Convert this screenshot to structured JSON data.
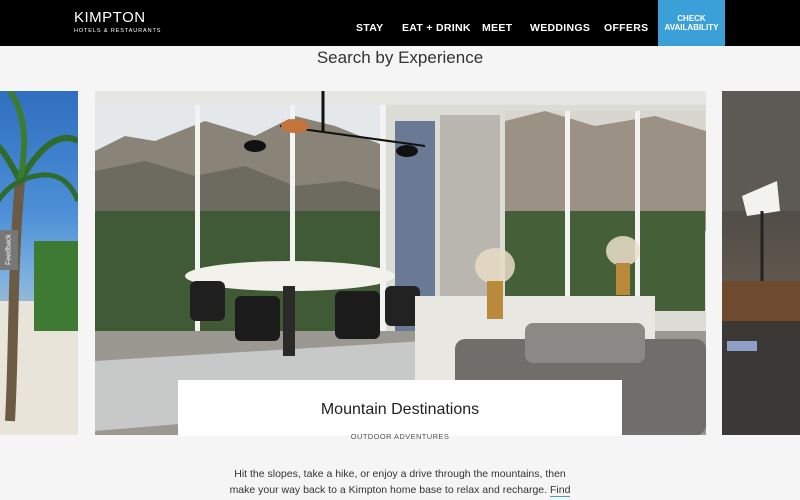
{
  "header": {
    "logo_main": "KIMPTON",
    "logo_sub": "HOTELS & RESTAURANTS",
    "nav": [
      "STAY",
      "EAT + DRINK",
      "MEET",
      "WEDDINGS",
      "OFFERS"
    ],
    "cta": "CHECK AVAILABILITY"
  },
  "section_title": "Search by Experience",
  "feedback_label": "Feedback",
  "slide": {
    "title": "Mountain Destinations",
    "subtitle": "OUTDOOR ADVENTURES",
    "description": "Hit the slopes, take a hike, or enjoy a drive through the mountains, then make your way back to a Kimpton home base to relax and recharge.",
    "link_text": "Find Mountain"
  },
  "colors": {
    "header_bg": "#000000",
    "cta_bg": "#3ca0d8",
    "page_bg": "#f4f5f4"
  }
}
